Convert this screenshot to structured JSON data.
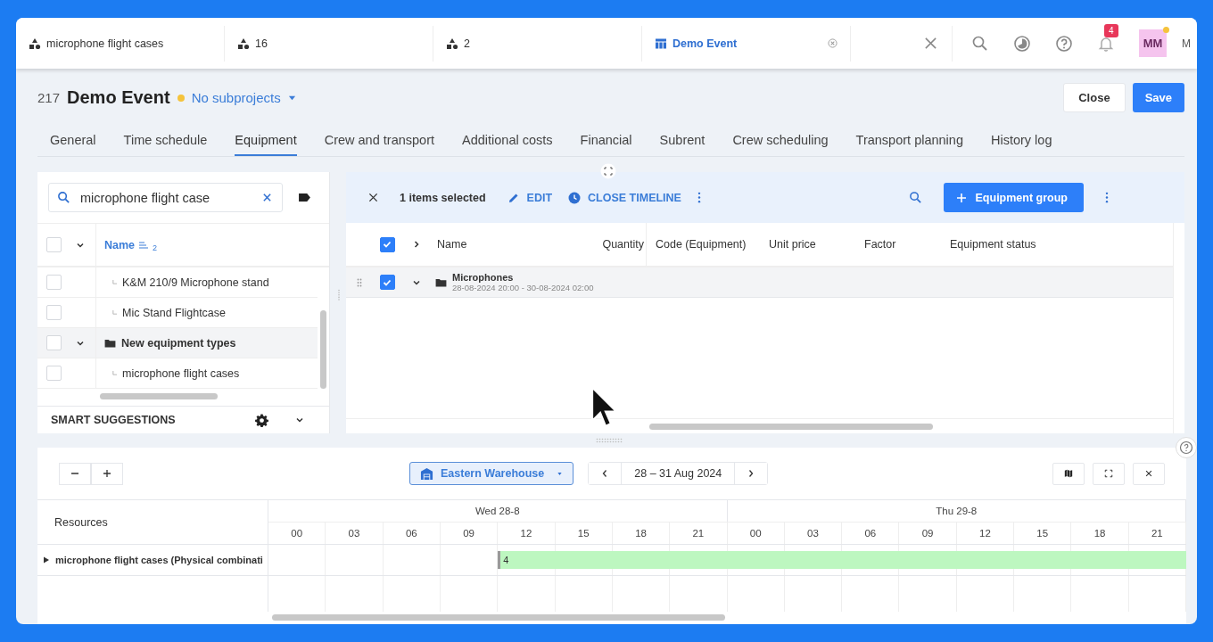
{
  "top_tabs": [
    {
      "label": "microphone flight cases",
      "kind": "shapes",
      "selected": false
    },
    {
      "label": "16",
      "kind": "shapes",
      "selected": false
    },
    {
      "label": "2",
      "kind": "shapes",
      "selected": false
    },
    {
      "label": "Demo Event",
      "kind": "table",
      "selected": true
    }
  ],
  "notifications": {
    "count": "4"
  },
  "user": {
    "initials": "MM",
    "name": "M"
  },
  "project": {
    "number": "217",
    "title": "Demo Event",
    "subprojects": "No subprojects",
    "close": "Close",
    "save": "Save"
  },
  "tabs": [
    {
      "label": "General",
      "selected": false
    },
    {
      "label": "Time schedule",
      "selected": false
    },
    {
      "label": "Equipment",
      "selected": true
    },
    {
      "label": "Crew and transport",
      "selected": false
    },
    {
      "label": "Additional costs",
      "selected": false
    },
    {
      "label": "Financial",
      "selected": false
    },
    {
      "label": "Subrent",
      "selected": false
    },
    {
      "label": "Crew scheduling",
      "selected": false
    },
    {
      "label": "Transport planning",
      "selected": false
    },
    {
      "label": "History log",
      "selected": false
    }
  ],
  "equipment_search": {
    "value": "microphone flight case"
  },
  "tree": {
    "header": {
      "label": "Name",
      "sort_order": "2",
      "checked": false
    },
    "rows": [
      {
        "children": [
          {
            "kind": "item",
            "label": "K&M 210/9 Microphone stand",
            "checked": false
          },
          {
            "kind": "item",
            "label": "Mic Stand Flightcase",
            "checked": false
          }
        ]
      },
      {
        "kind": "group",
        "label": "New equipment types",
        "checked": false,
        "expanded": true,
        "children": [
          {
            "kind": "item",
            "label": "microphone flight cases",
            "checked": false
          }
        ]
      }
    ]
  },
  "smart_suggestions": {
    "label": "SMART SUGGESTIONS",
    "expanded": false
  },
  "selection_bar": {
    "count": "1 items selected",
    "edit": "EDIT",
    "close_timeline": "CLOSE TIMELINE",
    "add_group": "Equipment group"
  },
  "equipment_table": {
    "header_checked": true,
    "header_expanded": false,
    "columns": [
      "Name",
      "Quantity",
      "Code (Equipment)",
      "Unit price",
      "Factor",
      "Equipment status"
    ],
    "rows": [
      {
        "name": "Microphones",
        "dates": "28-08-2024 20:00 - 30-08-2024 02:00",
        "checked": true,
        "expanded": true
      }
    ]
  },
  "timeline": {
    "warehouse": "Eastern Warehouse",
    "range": "28 – 31 Aug 2024",
    "resources_label": "Resources",
    "days": [
      {
        "label": "Wed 28-8",
        "hours": [
          "00",
          "03",
          "06",
          "09",
          "12",
          "15",
          "18",
          "21"
        ]
      },
      {
        "label": "Thu 29-8",
        "hours": [
          "00",
          "03",
          "06",
          "09",
          "12",
          "15",
          "18",
          "21"
        ]
      }
    ],
    "rows": [
      {
        "label": "microphone flight cases (Physical combinati",
        "expanded": false,
        "booking": "4",
        "slots": [
          {
            "booked": false
          },
          {
            "booked": false
          },
          {
            "booked": false
          },
          {
            "booked": false
          },
          {
            "booked": true
          },
          {
            "booked": true
          },
          {
            "booked": true
          },
          {
            "booked": true
          },
          {
            "booked": true
          },
          {
            "booked": true
          },
          {
            "booked": true
          },
          {
            "booked": true
          },
          {
            "booked": true
          },
          {
            "booked": true
          },
          {
            "booked": true
          },
          {
            "booked": true
          }
        ]
      }
    ]
  }
}
